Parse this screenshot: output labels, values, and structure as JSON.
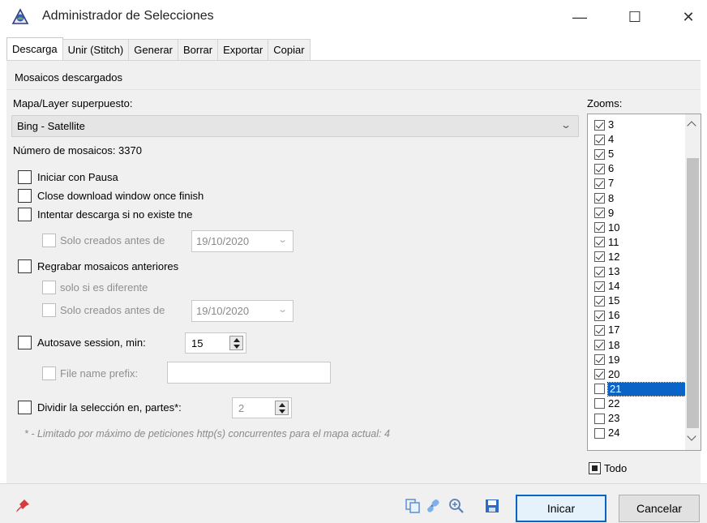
{
  "window": {
    "title": "Administrador de Selecciones",
    "minimize_glyph": "—",
    "maximize_glyph": "☐",
    "close_glyph": "✕"
  },
  "tabs": [
    {
      "label": "Descarga",
      "active": true
    },
    {
      "label": "Unir (Stitch)",
      "active": false
    },
    {
      "label": "Generar",
      "active": false
    },
    {
      "label": "Borrar",
      "active": false
    },
    {
      "label": "Exportar",
      "active": false
    },
    {
      "label": "Copiar",
      "active": false
    }
  ],
  "download": {
    "section_label": "Mosaicos descargados",
    "map_layer_label": "Mapa/Layer superpuesto:",
    "map_layer_value": "Bing - Satellite",
    "tile_count_label": "Número de mosaicos: 3370",
    "start_paused_label": "Iniciar con Pausa",
    "close_window_label": "Close download window once finish",
    "retry_label": "Intentar descarga si no existe tne",
    "only_before_label_1": "Solo creados antes de",
    "date_1": "19/10/2020",
    "rewrite_label": "Regrabar mosaicos anteriores",
    "only_if_different_label": "solo si es diferente",
    "only_before_label_2": "Solo creados antes de",
    "date_2": "19/10/2020",
    "autosave_label": "Autosave session, min:",
    "autosave_value": "15",
    "file_prefix_label": "File name prefix:",
    "file_prefix_value": "",
    "split_label": "Dividir la selección en, partes*:",
    "split_value": "2",
    "note": "* - Limitado por máximo de peticiones http(s) concurrentes para el mapa actual: 4"
  },
  "zooms": {
    "label": "Zooms:",
    "items": [
      {
        "level": "3",
        "checked": true
      },
      {
        "level": "4",
        "checked": true
      },
      {
        "level": "5",
        "checked": true
      },
      {
        "level": "6",
        "checked": true
      },
      {
        "level": "7",
        "checked": true
      },
      {
        "level": "8",
        "checked": true
      },
      {
        "level": "9",
        "checked": true
      },
      {
        "level": "10",
        "checked": true
      },
      {
        "level": "11",
        "checked": true
      },
      {
        "level": "12",
        "checked": true
      },
      {
        "level": "13",
        "checked": true
      },
      {
        "level": "14",
        "checked": true
      },
      {
        "level": "15",
        "checked": true
      },
      {
        "level": "16",
        "checked": true
      },
      {
        "level": "17",
        "checked": true
      },
      {
        "level": "18",
        "checked": true
      },
      {
        "level": "19",
        "checked": true
      },
      {
        "level": "20",
        "checked": true
      },
      {
        "level": "21",
        "checked": false,
        "selected": true
      },
      {
        "level": "22",
        "checked": false
      },
      {
        "level": "23",
        "checked": false
      },
      {
        "level": "24",
        "checked": false
      }
    ],
    "todo_label": "Todo"
  },
  "footer": {
    "start_label": "Inicar",
    "cancel_label": "Cancelar"
  },
  "colors": {
    "accent": "#0a64c8",
    "panel_bg": "#f0f0f0"
  }
}
